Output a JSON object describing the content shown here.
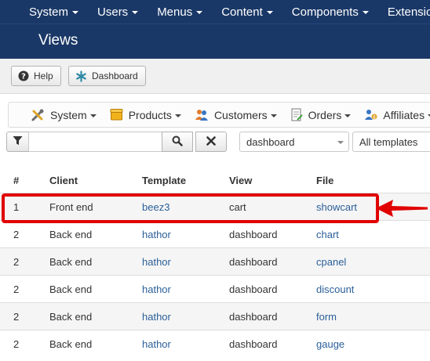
{
  "topnav": {
    "items": [
      {
        "label": "System"
      },
      {
        "label": "Users"
      },
      {
        "label": "Menus"
      },
      {
        "label": "Content"
      },
      {
        "label": "Components"
      },
      {
        "label": "Extensio"
      }
    ]
  },
  "header": {
    "title": "Views"
  },
  "toolbar": {
    "help_label": "Help",
    "dashboard_label": "Dashboard"
  },
  "submenu": {
    "items": [
      {
        "label": "System",
        "icon": "wrench-screwdriver-icon"
      },
      {
        "label": "Products",
        "icon": "box-icon"
      },
      {
        "label": "Customers",
        "icon": "users-icon"
      },
      {
        "label": "Orders",
        "icon": "document-icon"
      },
      {
        "label": "Affiliates",
        "icon": "affiliate-icon"
      }
    ]
  },
  "filters": {
    "search_value": "",
    "view_select": "dashboard",
    "template_select": "All templates"
  },
  "table": {
    "columns": [
      "#",
      "Client",
      "Template",
      "View",
      "File"
    ],
    "rows": [
      {
        "num": "1",
        "client": "Front end",
        "template": "beez3",
        "view": "cart",
        "file": "showcart"
      },
      {
        "num": "2",
        "client": "Back end",
        "template": "hathor",
        "view": "dashboard",
        "file": "chart"
      },
      {
        "num": "2",
        "client": "Back end",
        "template": "hathor",
        "view": "dashboard",
        "file": "cpanel"
      },
      {
        "num": "2",
        "client": "Back end",
        "template": "hathor",
        "view": "dashboard",
        "file": "discount"
      },
      {
        "num": "2",
        "client": "Back end",
        "template": "hathor",
        "view": "dashboard",
        "file": "form"
      },
      {
        "num": "2",
        "client": "Back end",
        "template": "hathor",
        "view": "dashboard",
        "file": "gauge"
      }
    ]
  },
  "colors": {
    "header_bg": "#1a3867",
    "link": "#2b5f98",
    "highlight": "#e00000"
  }
}
